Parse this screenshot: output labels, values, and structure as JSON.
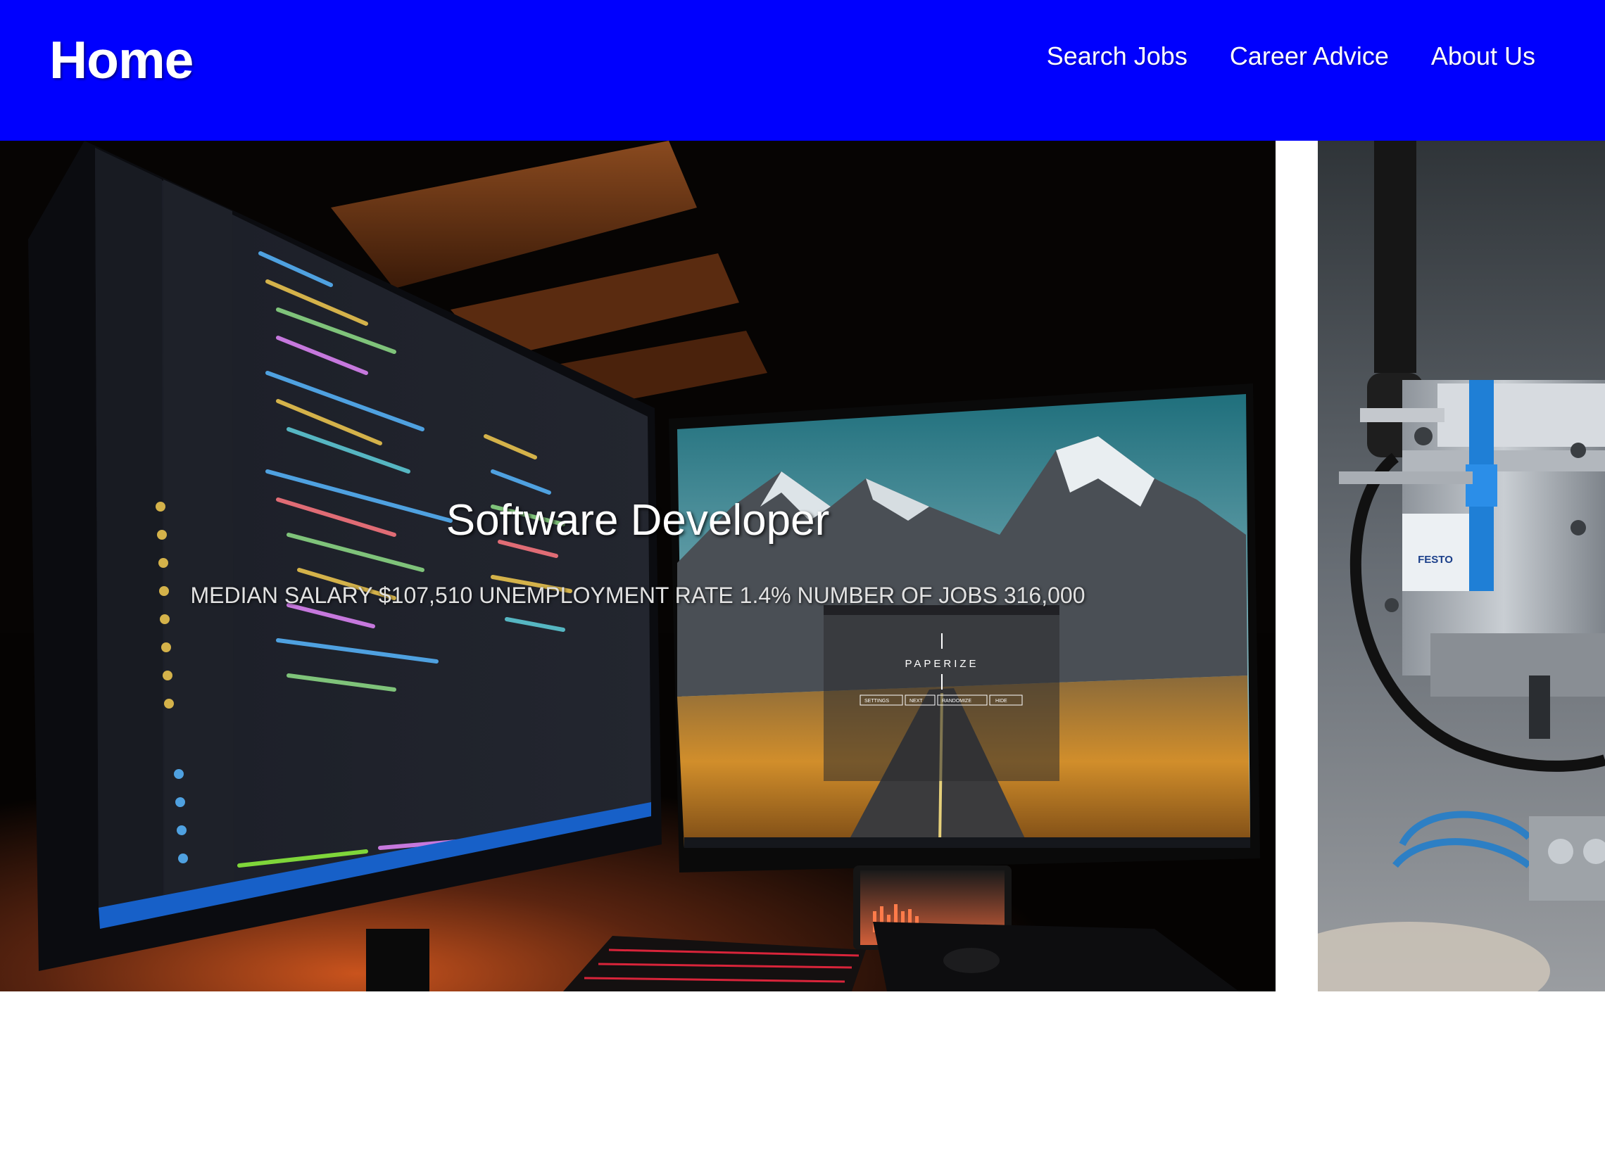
{
  "header": {
    "brand": "Home",
    "nav": [
      {
        "label": "Search Jobs"
      },
      {
        "label": "Career Advice"
      },
      {
        "label": "About Us"
      }
    ],
    "background_color": "#0000fe"
  },
  "carousel": {
    "active_slide": {
      "title": "Software Developer",
      "stats": "MEDIAN SALARY $107,510 UNEMPLOYMENT RATE 1.4% NUMBER OF JOBS 316,000",
      "photo_text": {
        "app_name": "PAPERIZE",
        "buttons": [
          "SETTINGS",
          "NEXT",
          "RANDOMIZE",
          "HIDE"
        ],
        "brand_label": "FESTO"
      }
    }
  }
}
